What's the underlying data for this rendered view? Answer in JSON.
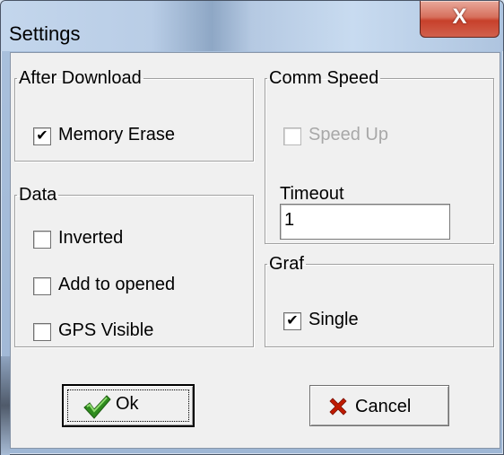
{
  "window": {
    "title": "Settings",
    "close_glyph": "X"
  },
  "after_download": {
    "legend": "After Download",
    "memory_erase": {
      "label": "Memory Erase",
      "checked": true,
      "check_glyph": "✔"
    }
  },
  "data_group": {
    "legend": "Data",
    "items": [
      {
        "label": "Inverted",
        "checked": false
      },
      {
        "label": "Add to opened",
        "checked": false
      },
      {
        "label": "GPS Visible",
        "checked": false
      }
    ]
  },
  "comm_speed": {
    "legend": "Comm Speed",
    "speed_up": {
      "label": "Speed Up",
      "checked": false,
      "disabled": true
    },
    "timeout_label": "Timeout",
    "timeout_value": "1"
  },
  "graf": {
    "legend": "Graf",
    "single": {
      "label": "Single",
      "checked": true,
      "check_glyph": "✔"
    }
  },
  "buttons": {
    "ok": {
      "label": "Ok",
      "icon": "checkmark-icon",
      "icon_color": "#2e8b1e"
    },
    "cancel": {
      "label": "Cancel",
      "icon": "cross-icon",
      "icon_color": "#c01a00"
    }
  }
}
